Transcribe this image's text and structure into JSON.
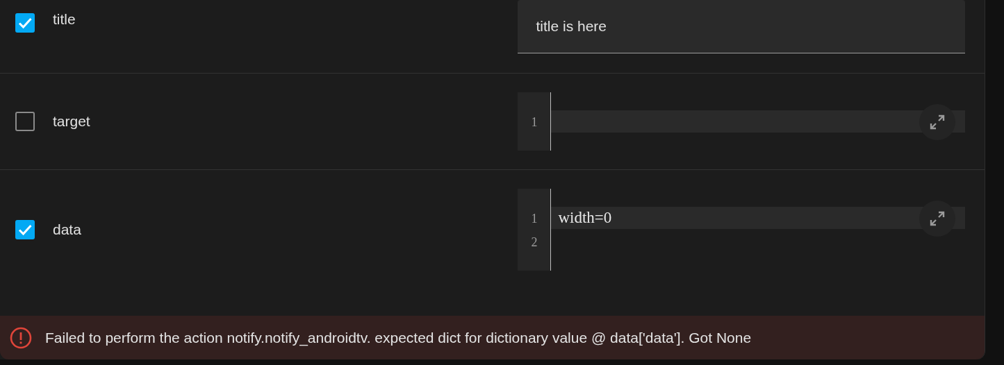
{
  "fields": [
    {
      "kind": "text",
      "label": "title",
      "checked": true,
      "value": "title is here"
    },
    {
      "kind": "code",
      "label": "target",
      "checked": false,
      "line_numbers": [
        "1"
      ]
    },
    {
      "kind": "code",
      "label": "data",
      "checked": true,
      "line_numbers": [
        "1",
        "2"
      ],
      "code_lines": [
        "width=0"
      ]
    }
  ],
  "error": {
    "message": "Failed to perform the action notify.notify_androidtv. expected dict for dictionary value @ data['data']. Got None"
  }
}
